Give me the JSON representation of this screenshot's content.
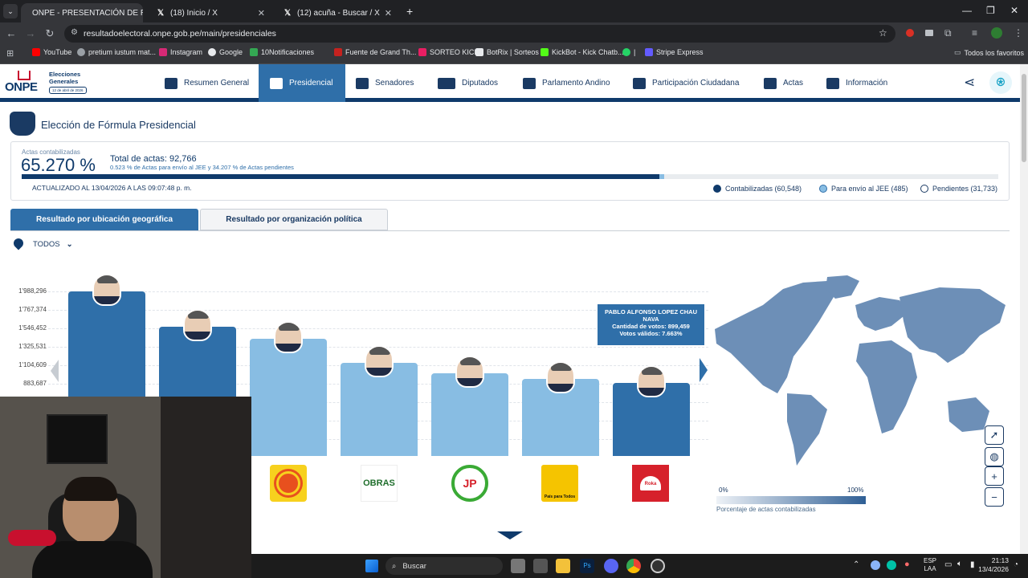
{
  "browser": {
    "tabs": [
      {
        "title": "ONPE - PRESENTACIÓN DE RESU"
      },
      {
        "title": "(18) Inicio / X"
      },
      {
        "title": "(12) acuña - Buscar / X"
      }
    ],
    "url": "resultadoelectoral.onpe.gob.pe/main/presidenciales",
    "bookmarks": [
      "YouTube",
      "pretium iustum mat...",
      "Instagram",
      "Google",
      "10Notificaciones",
      "Fuente de Grand Th...",
      "SORTEO KICK",
      "BotRix | Sorteos",
      "KickBot - Kick Chatb...",
      "|",
      "Stripe Express"
    ],
    "all_bookmarks": "Todos los favoritos"
  },
  "header": {
    "logo": "ONPE",
    "logo_sub1": "Elecciones",
    "logo_sub2": "Generales",
    "logo_date": "12 de abril de 2026",
    "nav": [
      "Resumen General",
      "Presidencial",
      "Senadores",
      "Diputados",
      "Parlamento Andino",
      "Participación Ciudadana",
      "Actas",
      "Información"
    ]
  },
  "page": {
    "title": "Elección de Fórmula Presidencial",
    "actas_label": "Actas contabilizadas",
    "actas_percent": "65.270 %",
    "total_actas": "Total de actas: 92,766",
    "actas_sub": "0.523 % de Actas para envío al JEE y 34.207 % de Actas pendientes",
    "progress_contabilizadas": 0.6527,
    "progress_jee": 0.00523,
    "updated": "ACTUALIZADO AL 13/04/2026 A LAS 09:07:48 p. m.",
    "legend": [
      "Contabilizadas (60,548)",
      "Para envío al JEE (485)",
      "Pendientes (31,733)"
    ],
    "tab_geo": "Resultado por ubicación geográfica",
    "tab_org": "Resultado por organización política",
    "location": "TODOS",
    "tooltip_name": "PABLO ALFONSO LOPEZ CHAU NAVA",
    "tooltip_votes": "Cantidad de votos: 899,459",
    "tooltip_valid": "Votos válidos: 7.663%",
    "map_scale_min": "0%",
    "map_scale_max": "100%",
    "map_scale_label": "Porcentaje de actas contabilizadas",
    "logos": [
      "",
      "OBRAS",
      "JP",
      "País para Todos",
      "Roka"
    ]
  },
  "chart_data": {
    "type": "bar",
    "yticks": [
      "1'988,296",
      "1'767,374",
      "1'546,452",
      "1'325,531",
      "1'104,609",
      "883,687"
    ],
    "series": [
      {
        "values": [
          2030000,
          1590000,
          1450000,
          1150000,
          1020000,
          950000,
          899459
        ]
      }
    ],
    "highlighted": [
      0,
      1,
      6
    ]
  },
  "taskbar": {
    "search": "Buscar",
    "lang1": "ESP",
    "lang2": "LAA",
    "time": "21:13",
    "date": "13/4/2026"
  },
  "colors": {
    "navy": "#0f3a6b",
    "blue": "#2f6fa9",
    "light": "#88bde3"
  }
}
